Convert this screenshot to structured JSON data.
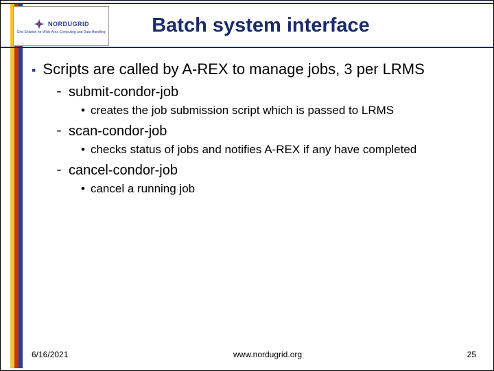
{
  "header": {
    "logo_brand": "NORDUGRID",
    "logo_tag": "Grid Solution for Wide Area Computing and Data Handling",
    "title": "Batch system interface"
  },
  "content": {
    "main_point": "Scripts are called by A-REX to manage jobs, 3 per LRMS",
    "items": [
      {
        "name": "submit-condor-job",
        "desc": "creates the job submission script which is passed to LRMS"
      },
      {
        "name": "scan-condor-job",
        "desc": "checks status of jobs and notifies A-REX if any have completed"
      },
      {
        "name": "cancel-condor-job",
        "desc": "cancel a running job"
      }
    ]
  },
  "footer": {
    "date": "6/16/2021",
    "url": "www.nordugrid.org",
    "page": "25"
  }
}
